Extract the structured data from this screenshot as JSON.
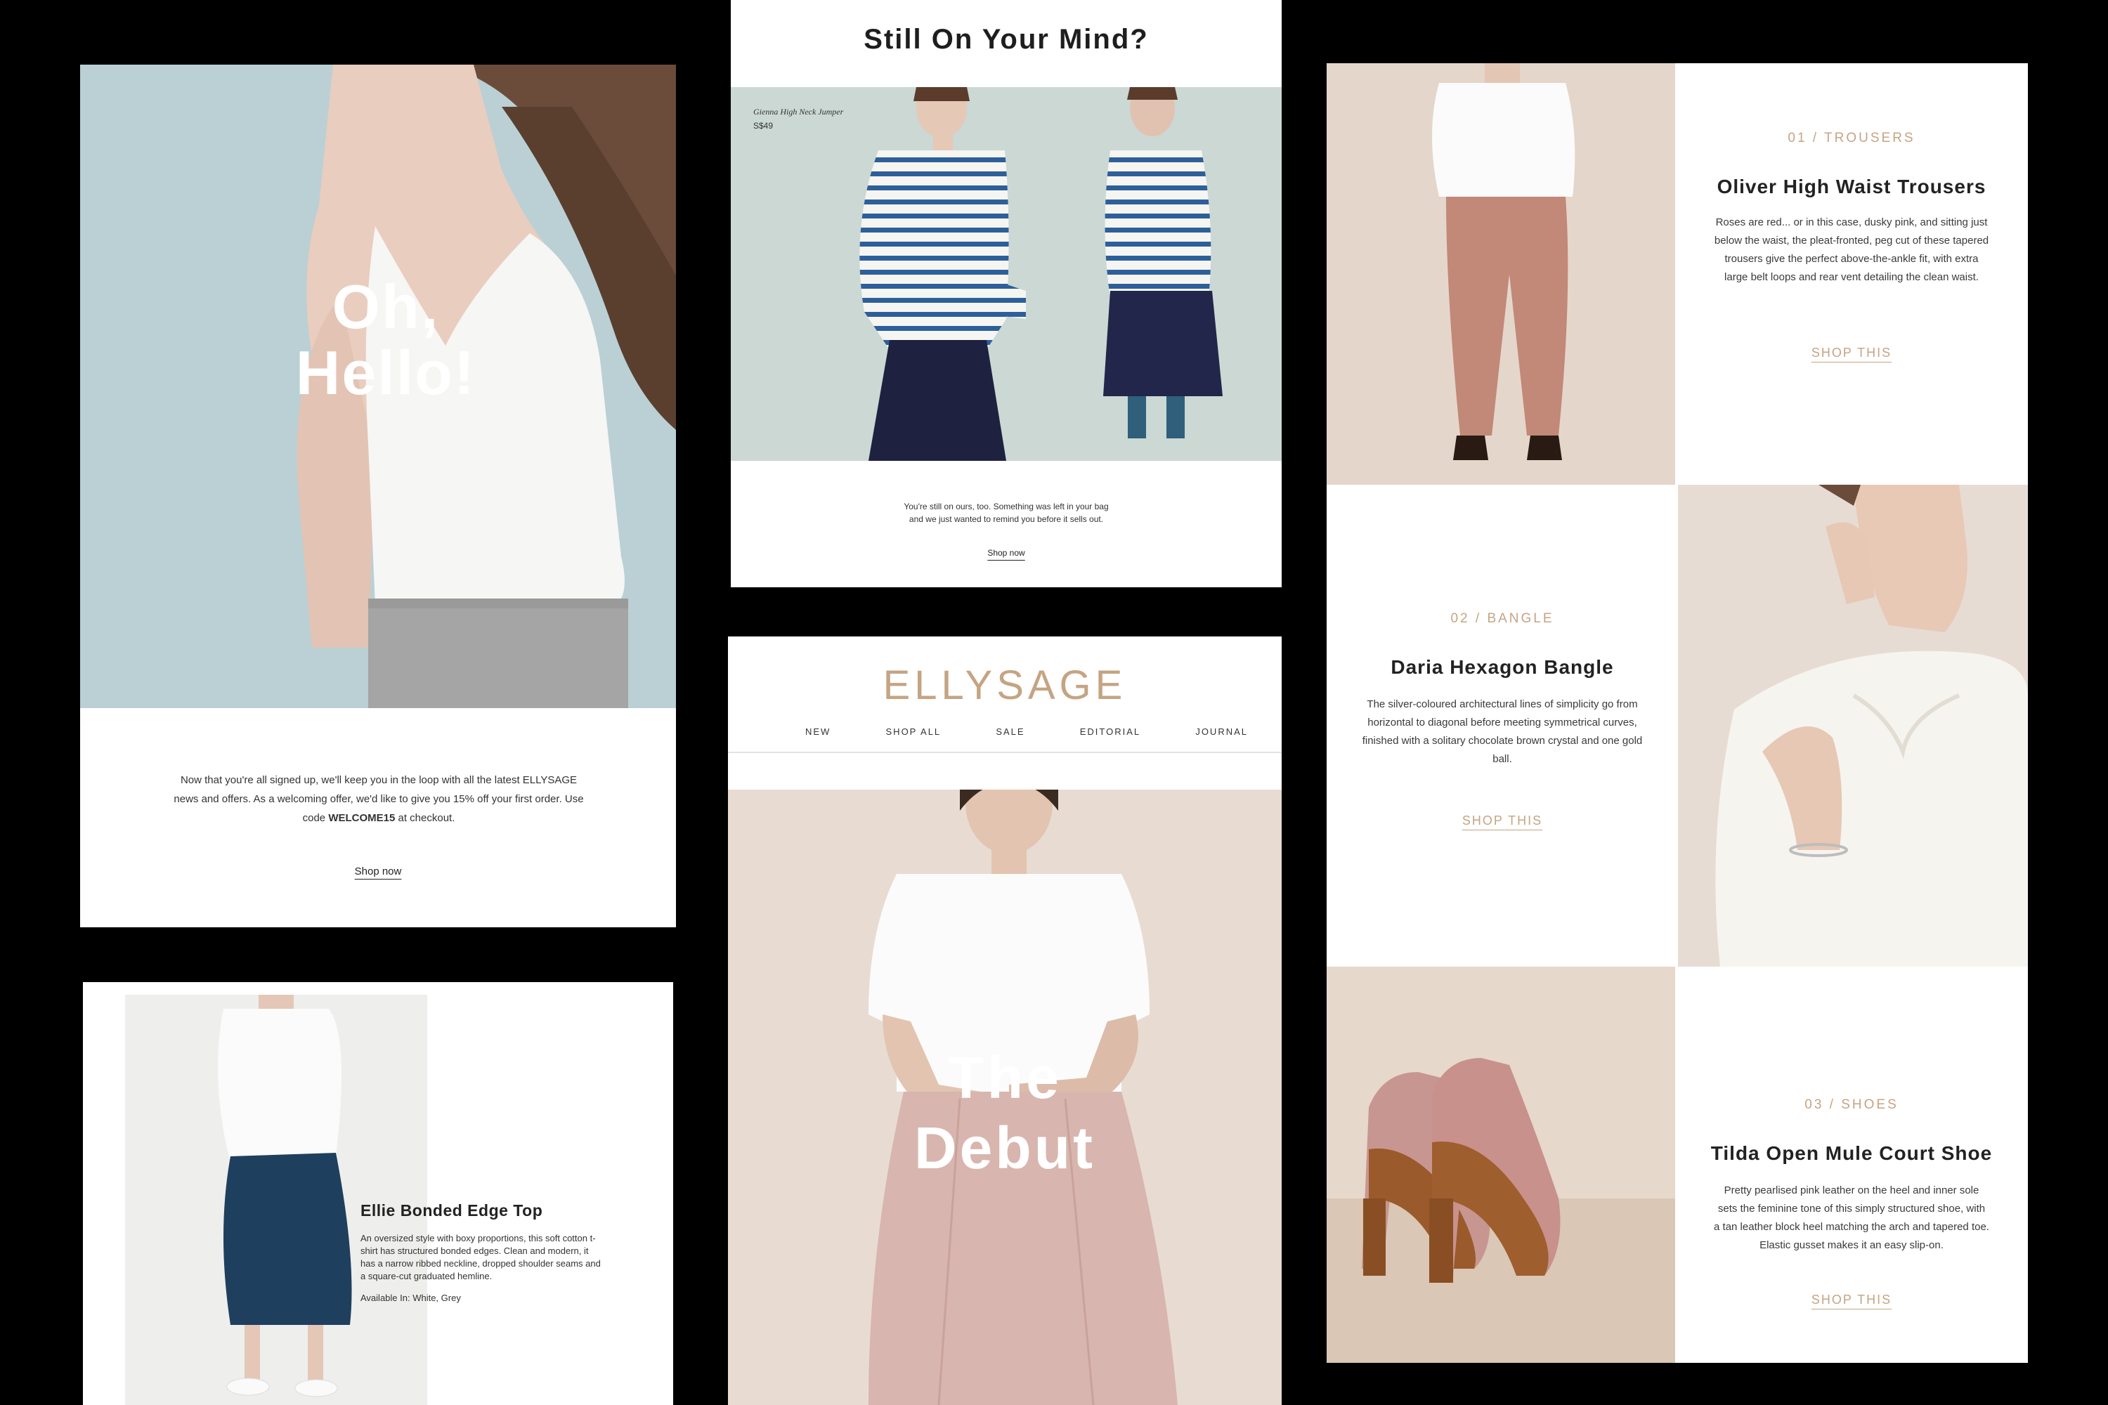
{
  "welcome": {
    "headline_1": "Oh,",
    "headline_2": "Hello!",
    "body_pre": "Now that you're all signed up, we'll keep you in the loop with all the latest ELLYSAGE news and offers. As a welcoming offer, we'd like to give you 15% off your first order. Use code ",
    "code": "WELCOME15",
    "body_post": " at checkout.",
    "cta": "Shop now"
  },
  "cart": {
    "title": "Still On Your Mind?",
    "product_name": "Gienna High Neck Jumper",
    "product_price": "S$49",
    "body_line_1": "You're still on ours, too. Something was left in your bag",
    "body_line_2": "and we just wanted to remind you before it sells out.",
    "cta": "Shop now"
  },
  "newsletter": {
    "brand": "ELLYSAGE",
    "nav": [
      "NEW",
      "SHOP ALL",
      "SALE",
      "EDITORIAL",
      "JOURNAL"
    ],
    "hero_line_1": "The",
    "hero_line_2": "Debut"
  },
  "product_feature": {
    "name": "Ellie Bonded Edge Top",
    "description": "An oversized style with boxy proportions, this soft cotton t-shirt has structured bonded edges. Clean and modern, it has a narrow ribbed neckline, dropped shoulder seams and a square-cut graduated hemline.",
    "availability": "Available In: White, Grey"
  },
  "grid": {
    "items": [
      {
        "eyebrow": "01 / TROUSERS",
        "title": "Oliver High Waist Trousers",
        "description": "Roses are red... or in this case, dusky pink, and sitting just below the waist, the pleat-fronted, peg cut of these tapered trousers give the perfect above-the-ankle fit, with extra large belt loops and rear vent detailing the clean waist.",
        "cta": "SHOP THIS"
      },
      {
        "eyebrow": "02 / BANGLE",
        "title": "Daria Hexagon Bangle",
        "description": "The silver-coloured architectural lines of simplicity go from horizontal to diagonal before meeting symmetrical curves, finished with a solitary chocolate brown crystal and one gold ball.",
        "cta": "SHOP THIS"
      },
      {
        "eyebrow": "03 / SHOES",
        "title": "Tilda Open Mule Court Shoe",
        "description": "Pretty pearlised pink leather on the heel and inner sole sets the feminine tone of this simply structured shoe, with a tan leather block heel matching the arch and tapered toe. Elastic gusset makes it an easy slip-on.",
        "cta": "SHOP THIS"
      }
    ]
  },
  "colors": {
    "background": "#000000",
    "accent_tan": "#c5a483",
    "hero_blue": "#b9d1d6",
    "beige": "#e6d9cf"
  }
}
